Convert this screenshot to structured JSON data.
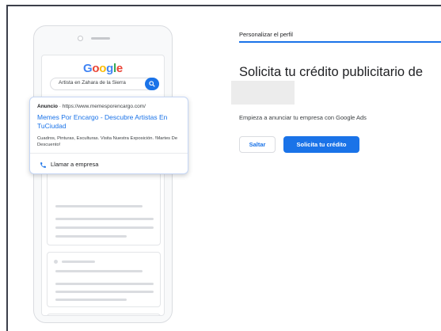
{
  "preview": {
    "logo": [
      "G",
      "o",
      "o",
      "g",
      "l",
      "e"
    ],
    "search_query": "Artista en Zahara de la Sierra",
    "ad": {
      "label": "Anuncio",
      "separator": " · ",
      "url": "https://www.memesporencargo.com/",
      "title": "Memes Por Encargo - Descubre Artistas En TuCiudad",
      "description": "Cuadros, Pinturas, Esculturas. Visita Nuestra Exposición. !Martes De Descuento!",
      "call_label": "Llamar a empresa"
    }
  },
  "panel": {
    "step_label": "Personalizar el perfil",
    "progress": 1.0,
    "headline": "Solicita tu crédito publicitario de",
    "subtitle": "Empieza a anunciar tu empresa con Google Ads",
    "skip_label": "Saltar",
    "apply_label": "Solicita tu crédito"
  },
  "colors": {
    "accent": "#1a73e8",
    "logo": [
      "#4285f4",
      "#ea4335",
      "#fbbc05",
      "#4285f4",
      "#34a853",
      "#ea4335"
    ]
  }
}
